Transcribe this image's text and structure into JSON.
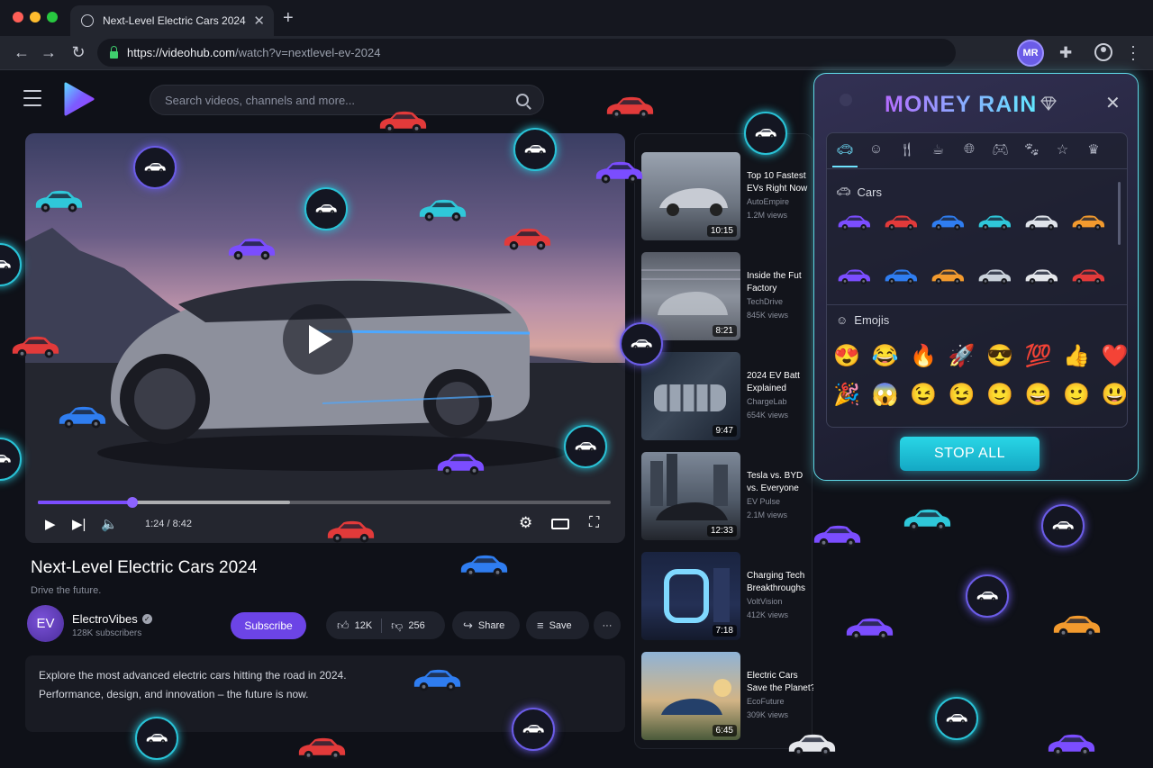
{
  "browser": {
    "tab_title": "Next-Level Electric Cars 2024",
    "url_domain": "https://videohub.com",
    "url_path": "/watch?v=nextlevel-ev-2024",
    "profile_initials": "MR"
  },
  "site": {
    "search_placeholder": "Search videos, channels and more..."
  },
  "player": {
    "current_time": "1:24",
    "duration": "8:42",
    "progress_fraction": 0.165,
    "buffer_fraction": 0.44
  },
  "video": {
    "title": "Next-Level Electric Cars 2024",
    "tagline": "Drive the future.",
    "channel_initials": "EV",
    "channel_name": "ElectroVibes",
    "subscribers": "128K subscribers",
    "subscribe_label": "Subscribe",
    "likes": "12K",
    "dislikes": "256",
    "share_label": "Share",
    "save_label": "Save",
    "description_line1": "Explore the most advanced electric cars hitting the road in 2024.",
    "description_line2": "Performance, design, and innovation – the future is now."
  },
  "related": [
    {
      "title_line1": "Top 10 Fastest",
      "title_line2": "EVs Right Now",
      "channel": "AutoEmpire",
      "views": "1.2M views",
      "duration": "10:15"
    },
    {
      "title_line1": "Inside the Fut",
      "title_line2": "Factory",
      "channel": "TechDrive",
      "views": "845K views",
      "duration": "8:21"
    },
    {
      "title_line1": "2024 EV Batt",
      "title_line2": "Explained",
      "channel": "ChargeLab",
      "views": "654K views",
      "duration": "9:47"
    },
    {
      "title_line1": "Tesla vs. BYD",
      "title_line2": "vs. Everyone",
      "channel": "EV Pulse",
      "views": "2.1M views",
      "duration": "12:33"
    },
    {
      "title_line1": "Charging Tech",
      "title_line2": "Breakthroughs",
      "channel": "VoltVision",
      "views": "412K views",
      "duration": "7:18"
    },
    {
      "title_line1": "Electric Cars",
      "title_line2": "Save the Planet?",
      "channel": "EcoFuture",
      "views": "309K views",
      "duration": "6:45"
    }
  ],
  "panel": {
    "title": "MONEY RAIN",
    "cars_label": "Cars",
    "emojis_label": "Emojis",
    "stop_label": "STOP ALL",
    "categories": [
      "car-icon",
      "smiley-icon",
      "food-icon",
      "drink-icon",
      "globe-icon",
      "gamepad-icon",
      "paw-icon",
      "star-icon",
      "crown-icon"
    ],
    "car_colors": [
      "#7b4dff",
      "#e23a3a",
      "#2f7df0",
      "#2fc7d9",
      "#dfe3ea",
      "#f29a2e",
      "#7b4dff",
      "#2f7df0",
      "#f29a2e",
      "#c9d1da",
      "#e4e6ea",
      "#e23a3a"
    ],
    "emojis": [
      "😍",
      "😂",
      "🔥",
      "🚀",
      "😎",
      "💯",
      "👍",
      "❤️",
      "🎉",
      "😱",
      "😉",
      "😉",
      "🙂",
      "😄",
      "🙂",
      "😃"
    ]
  }
}
